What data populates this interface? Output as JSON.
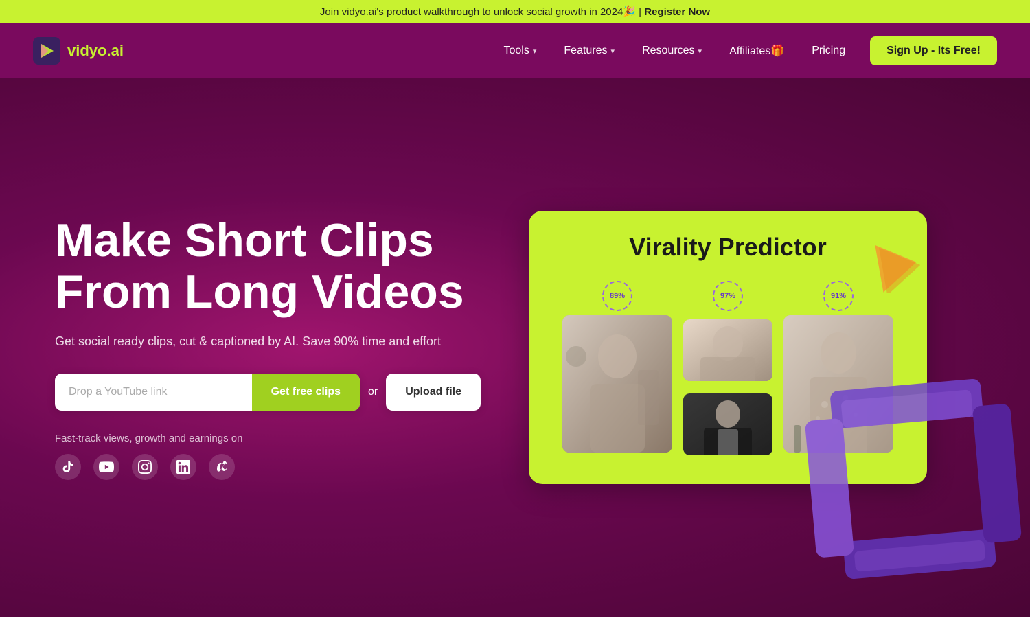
{
  "banner": {
    "text": "Join vidyo.ai's product walkthrough to unlock social growth in 2024🎉 |",
    "cta_text": "Register Now",
    "cta_href": "#"
  },
  "nav": {
    "logo_text_part1": "vidyo",
    "logo_text_part2": ".ai",
    "links": [
      {
        "label": "Tools",
        "has_dropdown": true
      },
      {
        "label": "Features",
        "has_dropdown": true
      },
      {
        "label": "Resources",
        "has_dropdown": true
      },
      {
        "label": "Affiliates🎁",
        "has_dropdown": false
      },
      {
        "label": "Pricing",
        "has_dropdown": false
      }
    ],
    "cta_label": "Sign Up - Its Free!"
  },
  "hero": {
    "title_line1": "Make Short Clips",
    "title_line2": "From Long Videos",
    "subtitle": "Get social ready clips, cut & captioned by AI. Save 90% time and effort",
    "input_placeholder": "Drop a YouTube link",
    "btn_get_clips": "Get free clips",
    "btn_or": "or",
    "btn_upload": "Upload file",
    "social_label": "Fast-track views, growth and earnings on"
  },
  "virality": {
    "title": "Virality Predictor",
    "thumbnails": [
      {
        "score": "89%",
        "type": "main"
      },
      {
        "score": "97%",
        "type": "sub_top"
      },
      {
        "score": "91%",
        "type": "main2"
      },
      {
        "score": "",
        "type": "sub_bottom"
      }
    ]
  },
  "colors": {
    "accent_green": "#c8f230",
    "brand_purple": "#7a0a5e",
    "hero_bg_start": "#a0156e",
    "hero_bg_end": "#4a0535"
  }
}
